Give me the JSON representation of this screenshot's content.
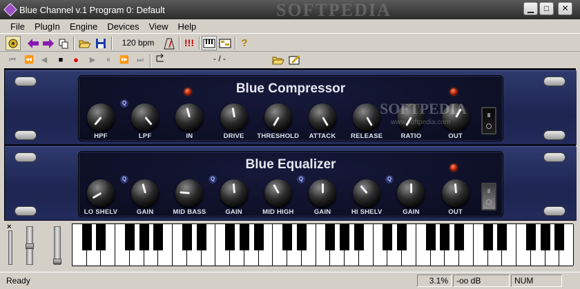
{
  "window": {
    "title": "Blue Channel v.1 Program 0: Default",
    "watermark": "SOFTPEDIA"
  },
  "title_buttons": {
    "minimize": "▁",
    "maximize": "□",
    "close": "✕"
  },
  "menu": [
    "File",
    "PlugIn",
    "Engine",
    "Devices",
    "View",
    "Help"
  ],
  "toolbar": {
    "bpm": "120 bpm",
    "panic": "!!!",
    "help": "?"
  },
  "transport": {
    "position": "- / -"
  },
  "compressor": {
    "title": "Blue Compressor",
    "q": "Q",
    "knobs": [
      {
        "label": "HPF",
        "angle": 220
      },
      {
        "label": "LPF",
        "angle": 140
      },
      {
        "label": "IN",
        "angle": 345
      },
      {
        "label": "DRIVE",
        "angle": 350
      },
      {
        "label": "THRESHOLD",
        "angle": 210
      },
      {
        "label": "ATTACK",
        "angle": 150
      },
      {
        "label": "RELEASE",
        "angle": 150
      },
      {
        "label": "RATIO",
        "angle": 210
      },
      {
        "label": "OUT",
        "angle": 30
      }
    ],
    "watermark": "SOFTPEDIA",
    "watermark_url": "www.softpedia.com"
  },
  "equalizer": {
    "title": "Blue Equalizer",
    "q": "Q",
    "knobs": [
      {
        "label": "LO SHELV",
        "angle": 240
      },
      {
        "label": "GAIN",
        "angle": 345
      },
      {
        "label": "MID BASS",
        "angle": 275
      },
      {
        "label": "GAIN",
        "angle": 355
      },
      {
        "label": "MID HIGH",
        "angle": 330
      },
      {
        "label": "GAIN",
        "angle": 0
      },
      {
        "label": "HI SHELV",
        "angle": 320
      },
      {
        "label": "GAIN",
        "angle": 0
      },
      {
        "label": "OUT",
        "angle": 355
      }
    ]
  },
  "keyboard": {
    "close": "×",
    "white_keys": 35
  },
  "status": {
    "text": "Ready",
    "cpu": "3.1%",
    "level": "-oo dB",
    "num": "NUM"
  }
}
